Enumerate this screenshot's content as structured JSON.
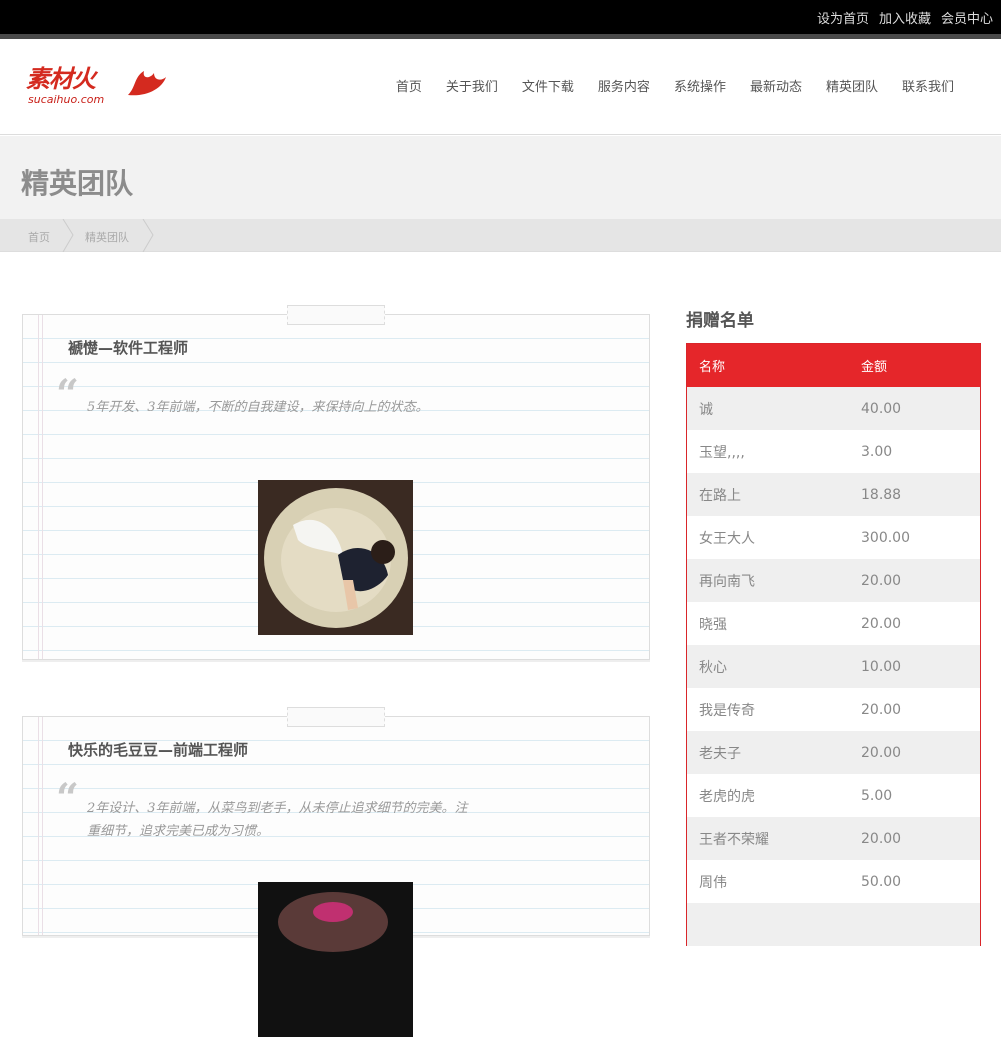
{
  "topbar": {
    "links": [
      "设为首页",
      "加入收藏",
      "会员中心"
    ]
  },
  "logo": {
    "cn": "素材火",
    "en": "sucaihuo.com"
  },
  "nav": {
    "items": [
      "首页",
      "关于我们",
      "文件下载",
      "服务内容",
      "系统操作",
      "最新动态",
      "精英团队",
      "联系我们"
    ],
    "active": "精英团队"
  },
  "page": {
    "title": "精英团队"
  },
  "breadcrumb": [
    "首页",
    "精英团队"
  ],
  "members": [
    {
      "title": "褫憷—软件工程师",
      "quote": "5年开发、3年前端，不断的自我建设，来保持向上的状态。"
    },
    {
      "title": "快乐的毛豆豆—前端工程师",
      "quote": "2年设计、3年前端，从菜鸟到老手，从未停止追求细节的完美。注重细节，追求完美已成为习惯。"
    }
  ],
  "donations": {
    "title": "捐赠名单",
    "headers": [
      "名称",
      "金额"
    ],
    "rows": [
      [
        "诚",
        "40.00"
      ],
      [
        "玉望,,,,",
        "3.00"
      ],
      [
        "在路上",
        "18.88"
      ],
      [
        "女王大人",
        "300.00"
      ],
      [
        "再向南飞",
        "20.00"
      ],
      [
        "晓强",
        "20.00"
      ],
      [
        "秋心",
        "10.00"
      ],
      [
        "我是传奇",
        "20.00"
      ],
      [
        "老夫子",
        "20.00"
      ],
      [
        "老虎的虎",
        "5.00"
      ],
      [
        "王者不荣耀",
        "20.00"
      ],
      [
        "周伟",
        "50.00"
      ]
    ]
  },
  "colors": {
    "accent": "#e5262a",
    "topbar": "#000000"
  }
}
